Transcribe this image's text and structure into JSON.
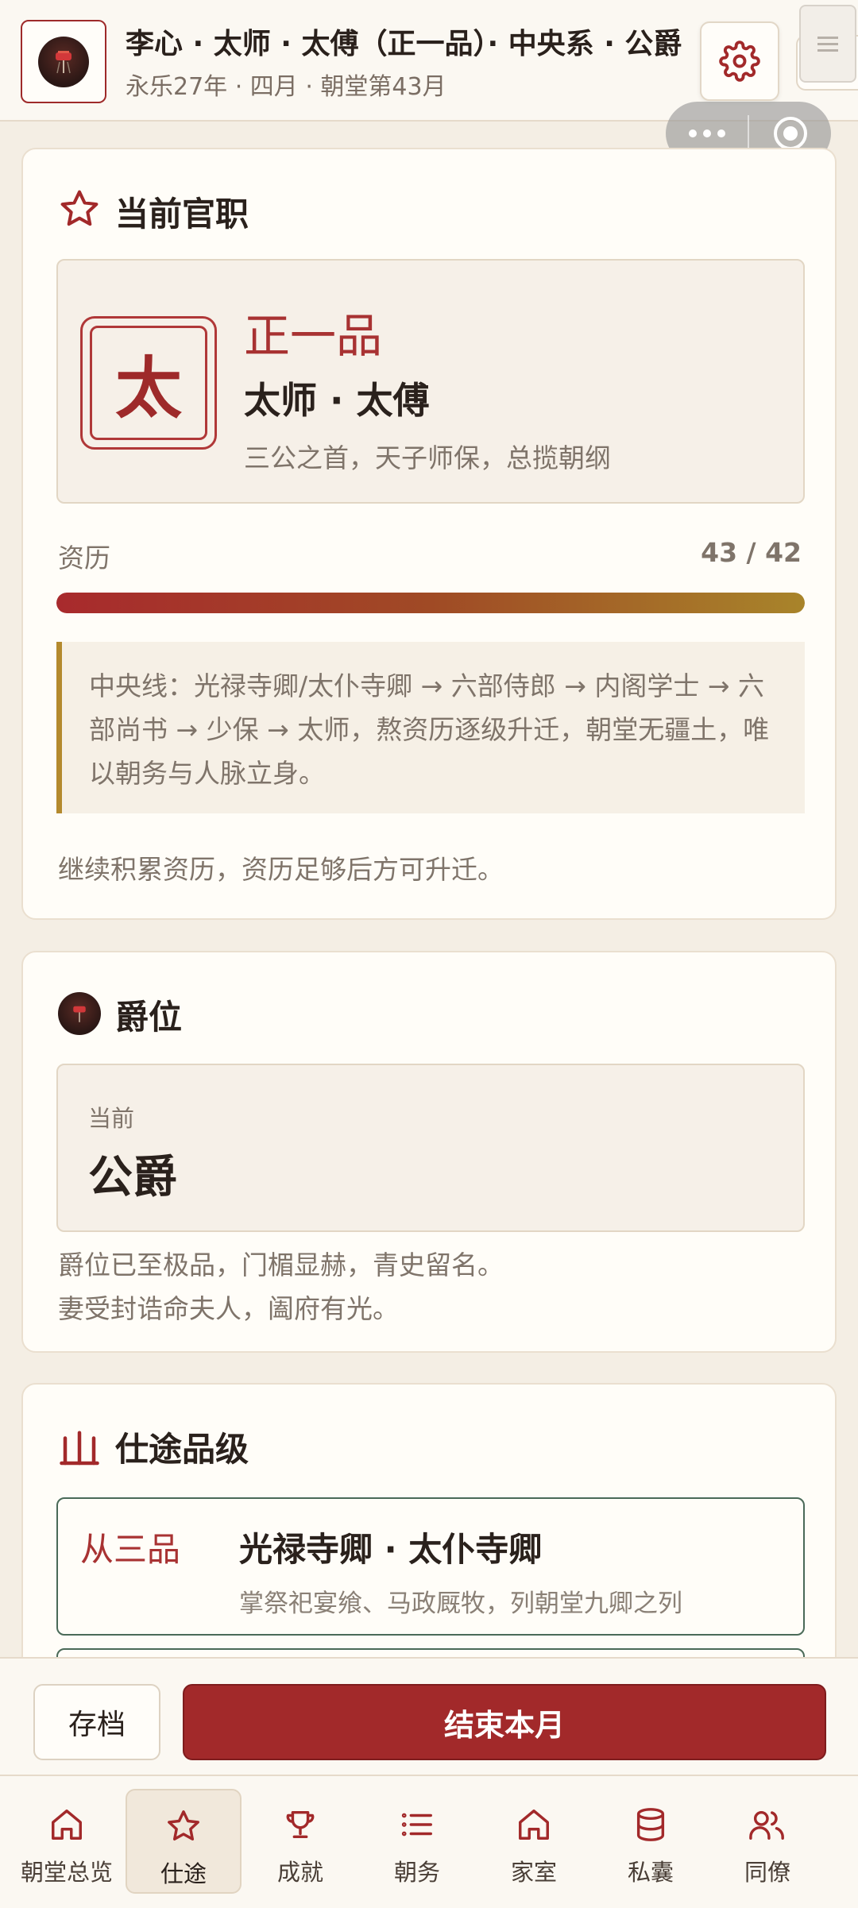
{
  "header": {
    "title": "李心 · 太师 · 太傅（正一品）· 中央系 · 公爵",
    "subtitle": "永乐27年 · 四月 · 朝堂第43月"
  },
  "office_card": {
    "title": "当前官职",
    "seal_char": "太",
    "rank": "正一品",
    "name": "太师 · 太傅",
    "description": "三公之首，天子师保，总揽朝纲",
    "xp_label": "资历",
    "xp_value": "43 / 42",
    "xp_progress": 1.0,
    "path_note": "中央线：光禄寺卿/太仆寺卿 → 六部侍郎 → 内阁学士 → 六部尚书 → 少保 → 太师，熬资历逐级升迁，朝堂无疆土，唯以朝务与人脉立身。",
    "footer": "继续积累资历，资历足够后方可升迁。"
  },
  "peerage_card": {
    "title": "爵位",
    "current_label": "当前",
    "current_title": "公爵",
    "desc_line1": "爵位已至极品，门楣显赫，青史留名。",
    "desc_line2": "妻受封诰命夫人，阖府有光。"
  },
  "career_card": {
    "title": "仕途品级",
    "items": [
      {
        "grade": "从三品",
        "name": "光禄寺卿 · 太仆寺卿",
        "desc": "掌祭祀宴飨、马政厩牧，列朝堂九卿之列"
      }
    ]
  },
  "actions": {
    "save_label": "存档",
    "end_label": "结束本月"
  },
  "nav": {
    "items": [
      {
        "label": "朝堂总览",
        "icon": "home-icon"
      },
      {
        "label": "仕途",
        "icon": "star-icon"
      },
      {
        "label": "成就",
        "icon": "trophy-icon"
      },
      {
        "label": "朝务",
        "icon": "list-icon"
      },
      {
        "label": "家室",
        "icon": "home-icon"
      },
      {
        "label": "私囊",
        "icon": "database-icon"
      },
      {
        "label": "同僚",
        "icon": "users-icon"
      }
    ],
    "active_index": 1
  },
  "colors": {
    "accent": "#A2292A",
    "background": "#F4EEE4",
    "card": "#FFFDF8",
    "progress_start": "#A82A2D",
    "progress_end": "#A8842A"
  }
}
